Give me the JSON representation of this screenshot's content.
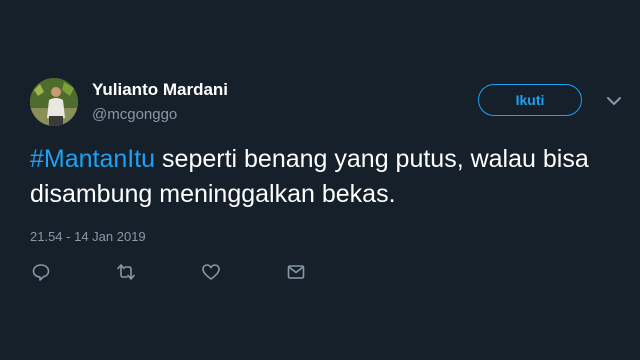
{
  "tweet": {
    "author": {
      "display_name": "Yulianto Mardani",
      "handle": "@mcgonggo",
      "avatar_icon": "profile-photo"
    },
    "follow_button_label": "Ikuti",
    "more_icon": "chevron-down-icon",
    "text": {
      "hashtag": "#MantanItu",
      "body": " seperti benang yang putus, walau bisa disambung meninggalkan bekas."
    },
    "timestamp": "21.54 - 14 Jan 2019",
    "actions": [
      {
        "name": "reply",
        "icon": "comment-icon"
      },
      {
        "name": "retweet",
        "icon": "retweet-icon"
      },
      {
        "name": "like",
        "icon": "heart-icon"
      },
      {
        "name": "direct-message",
        "icon": "envelope-icon"
      }
    ]
  },
  "colors": {
    "background": "#15202b",
    "accent": "#1da1f2",
    "secondary_text": "#8899a6",
    "primary_text": "#ffffff"
  }
}
